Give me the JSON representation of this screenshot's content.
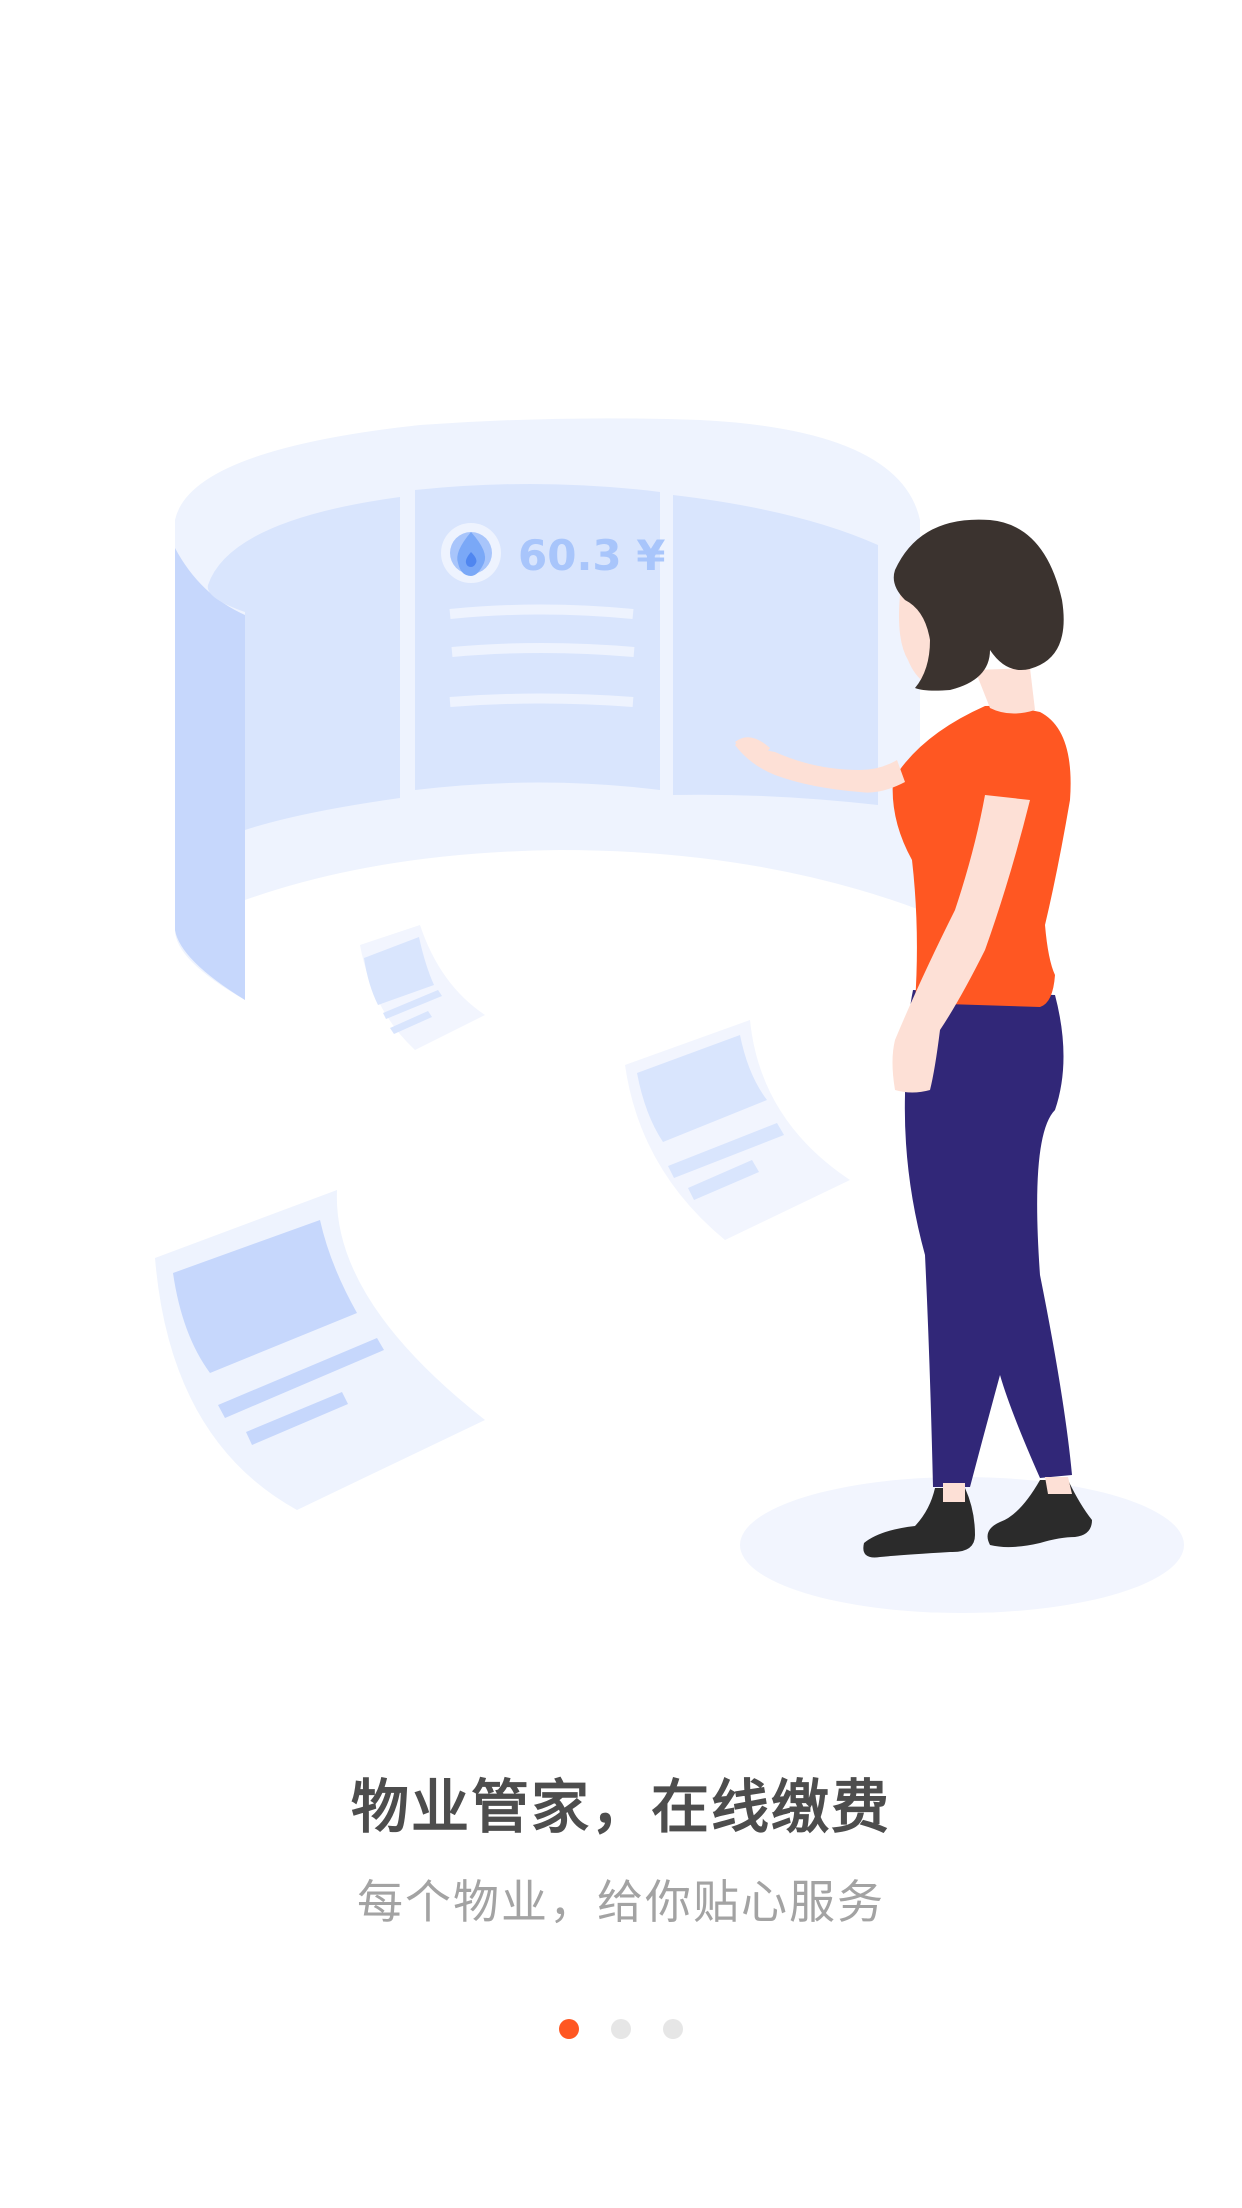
{
  "onboarding": {
    "title": "物业管家，在线缴费",
    "subtitle": "每个物业，给你贴心服务",
    "illustration": {
      "bill_amount": "60.3 ¥",
      "icon": "water-drop-icon"
    },
    "pagination": {
      "total_pages": 3,
      "current_page": 1
    }
  },
  "colors": {
    "accent": "#ff5722",
    "dot_inactive": "#e6e6e6",
    "title": "#4d4d4d",
    "subtitle": "#a3a3a3",
    "panel_blue": "#d9e5fd",
    "shirt": "#ff5722",
    "pants": "#312778"
  }
}
